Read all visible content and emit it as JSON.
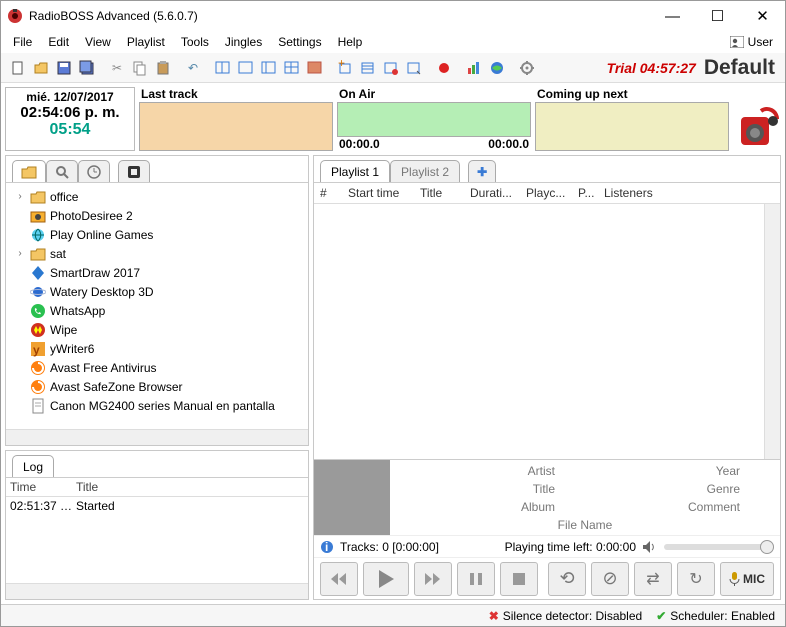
{
  "window": {
    "title": "RadioBOSS Advanced (5.6.0.7)"
  },
  "menus": [
    "File",
    "Edit",
    "View",
    "Playlist",
    "Tools",
    "Jingles",
    "Settings",
    "Help"
  ],
  "user_label": "User",
  "trial": "Trial 04:57:27",
  "profile": "Default",
  "clock": {
    "date": "mié. 12/07/2017",
    "time": "02:54:06 p. m.",
    "countdown": "05:54"
  },
  "last_track": {
    "label": "Last track"
  },
  "on_air": {
    "label": "On Air",
    "t1": "00:00.0",
    "t2": "00:00.0"
  },
  "next": {
    "label": "Coming up next"
  },
  "tree_items": [
    {
      "exp": "›",
      "icon": "folder",
      "label": "office"
    },
    {
      "exp": "",
      "icon": "camera",
      "label": "PhotoDesiree 2"
    },
    {
      "exp": "",
      "icon": "globe",
      "label": "Play Online Games"
    },
    {
      "exp": "›",
      "icon": "folder",
      "label": "sat"
    },
    {
      "exp": "",
      "icon": "blue",
      "label": "SmartDraw 2017"
    },
    {
      "exp": "",
      "icon": "planet",
      "label": "Watery Desktop 3D"
    },
    {
      "exp": "",
      "icon": "whatsapp",
      "label": "WhatsApp"
    },
    {
      "exp": "",
      "icon": "wipe",
      "label": "Wipe"
    },
    {
      "exp": "",
      "icon": "ywriter",
      "label": "yWriter6"
    },
    {
      "exp": "",
      "icon": "avast",
      "label": "Avast Free Antivirus"
    },
    {
      "exp": "",
      "icon": "avast",
      "label": "Avast SafeZone Browser"
    },
    {
      "exp": "",
      "icon": "doc",
      "label": "Canon MG2400 series Manual en pantalla"
    }
  ],
  "log": {
    "tab": "Log",
    "headers": [
      "Time",
      "Title"
    ],
    "rows": [
      [
        "02:51:37 p...",
        "Started"
      ]
    ]
  },
  "playlist": {
    "tabs": [
      "Playlist 1",
      "Playlist 2"
    ],
    "headers": [
      "#",
      "Start time",
      "Title",
      "Durati...",
      "Playc...",
      "P...",
      "Listeners"
    ]
  },
  "meta": {
    "artist": "Artist",
    "year": "Year",
    "title": "Title",
    "genre": "Genre",
    "album": "Album",
    "comment": "Comment",
    "filename": "File Name"
  },
  "info": {
    "tracks": "Tracks: 0 [0:00:00]",
    "playing": "Playing time left: 0:00:00"
  },
  "mic": "MIC",
  "status": {
    "silence": "Silence detector: Disabled",
    "scheduler": "Scheduler: Enabled"
  }
}
